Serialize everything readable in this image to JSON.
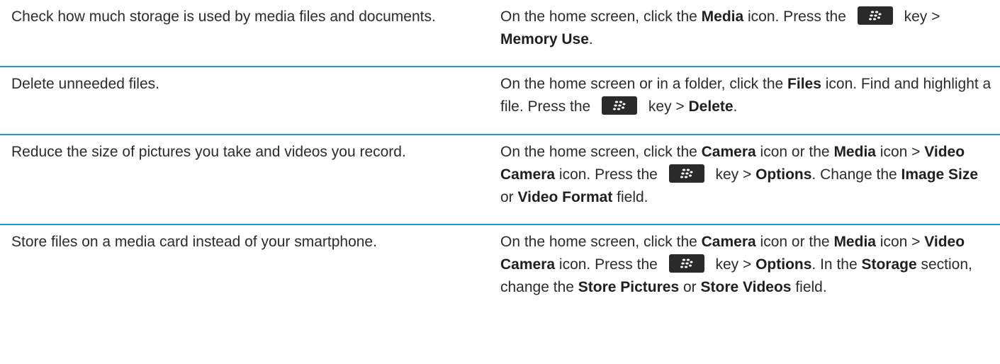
{
  "rows": [
    {
      "task": "Check how much storage is used by media files and documents.",
      "steps": [
        {
          "t": "On the home screen, click the "
        },
        {
          "b": "Media"
        },
        {
          "t": " icon. Press the "
        },
        {
          "key": "menu-key-icon"
        },
        {
          "t": " key > "
        },
        {
          "b": "Memory Use"
        },
        {
          "t": "."
        }
      ]
    },
    {
      "task": "Delete unneeded files.",
      "steps": [
        {
          "t": "On the home screen or in a folder, click the "
        },
        {
          "b": "Files"
        },
        {
          "t": " icon. Find and highlight a file. Press the "
        },
        {
          "key": "menu-key-icon"
        },
        {
          "t": " key > "
        },
        {
          "b": "Delete"
        },
        {
          "t": "."
        }
      ]
    },
    {
      "task": "Reduce the size of pictures you take and videos you record.",
      "steps": [
        {
          "t": "On the home screen, click the "
        },
        {
          "b": "Camera"
        },
        {
          "t": " icon or the "
        },
        {
          "b": "Media"
        },
        {
          "t": " icon > "
        },
        {
          "b": "Video Camera"
        },
        {
          "t": " icon. Press the "
        },
        {
          "key": "menu-key-icon"
        },
        {
          "t": " key > "
        },
        {
          "b": "Options"
        },
        {
          "t": ". Change the "
        },
        {
          "b": "Image Size"
        },
        {
          "t": " or "
        },
        {
          "b": "Video Format"
        },
        {
          "t": " field."
        }
      ]
    },
    {
      "task": "Store files on a media card instead of your smartphone.",
      "steps": [
        {
          "t": "On the home screen, click the "
        },
        {
          "b": "Camera"
        },
        {
          "t": " icon or the "
        },
        {
          "b": "Media"
        },
        {
          "t": " icon > "
        },
        {
          "b": "Video Camera"
        },
        {
          "t": " icon. Press the "
        },
        {
          "key": "menu-key-icon"
        },
        {
          "t": " key > "
        },
        {
          "b": "Options"
        },
        {
          "t": ". In the "
        },
        {
          "b": "Storage"
        },
        {
          "t": " section, change the "
        },
        {
          "b": "Store Pictures"
        },
        {
          "t": " or "
        },
        {
          "b": "Store Videos"
        },
        {
          "t": " field."
        }
      ]
    }
  ],
  "colors": {
    "rule": "#1a9bd7",
    "text": "#2b2b2b",
    "key_bg": "#2a2a2a"
  }
}
